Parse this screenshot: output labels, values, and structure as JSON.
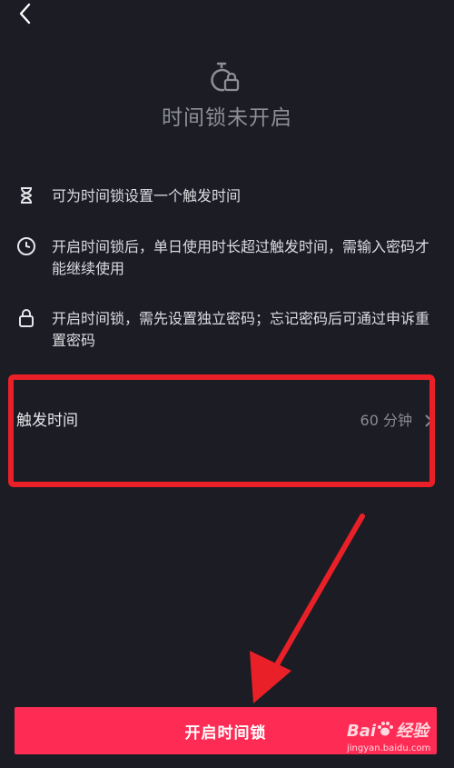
{
  "header": {
    "back_icon": "chevron-left-icon"
  },
  "hero": {
    "icon": "timer-lock-icon",
    "title": "时间锁未开启"
  },
  "rules": [
    {
      "icon": "hourglass-icon",
      "text": "可为时间锁设置一个触发时间"
    },
    {
      "icon": "clock-icon",
      "text": "开启时间锁后，单日使用时长超过触发时间，需输入密码才能继续使用"
    },
    {
      "icon": "lock-icon",
      "text": "开启时间锁，需先设置独立密码；忘记密码后可通过申诉重置密码"
    }
  ],
  "trigger": {
    "label": "触发时间",
    "value": "60 分钟",
    "chevron_icon": "chevron-right-icon"
  },
  "action": {
    "label": "开启时间锁"
  },
  "watermark": {
    "brand_left": "Bai",
    "brand_right": "经验",
    "url": "jingyan.baidu.com"
  },
  "colors": {
    "background": "#1b1c24",
    "accent": "#fe2c55",
    "annotation": "#ea2028"
  }
}
